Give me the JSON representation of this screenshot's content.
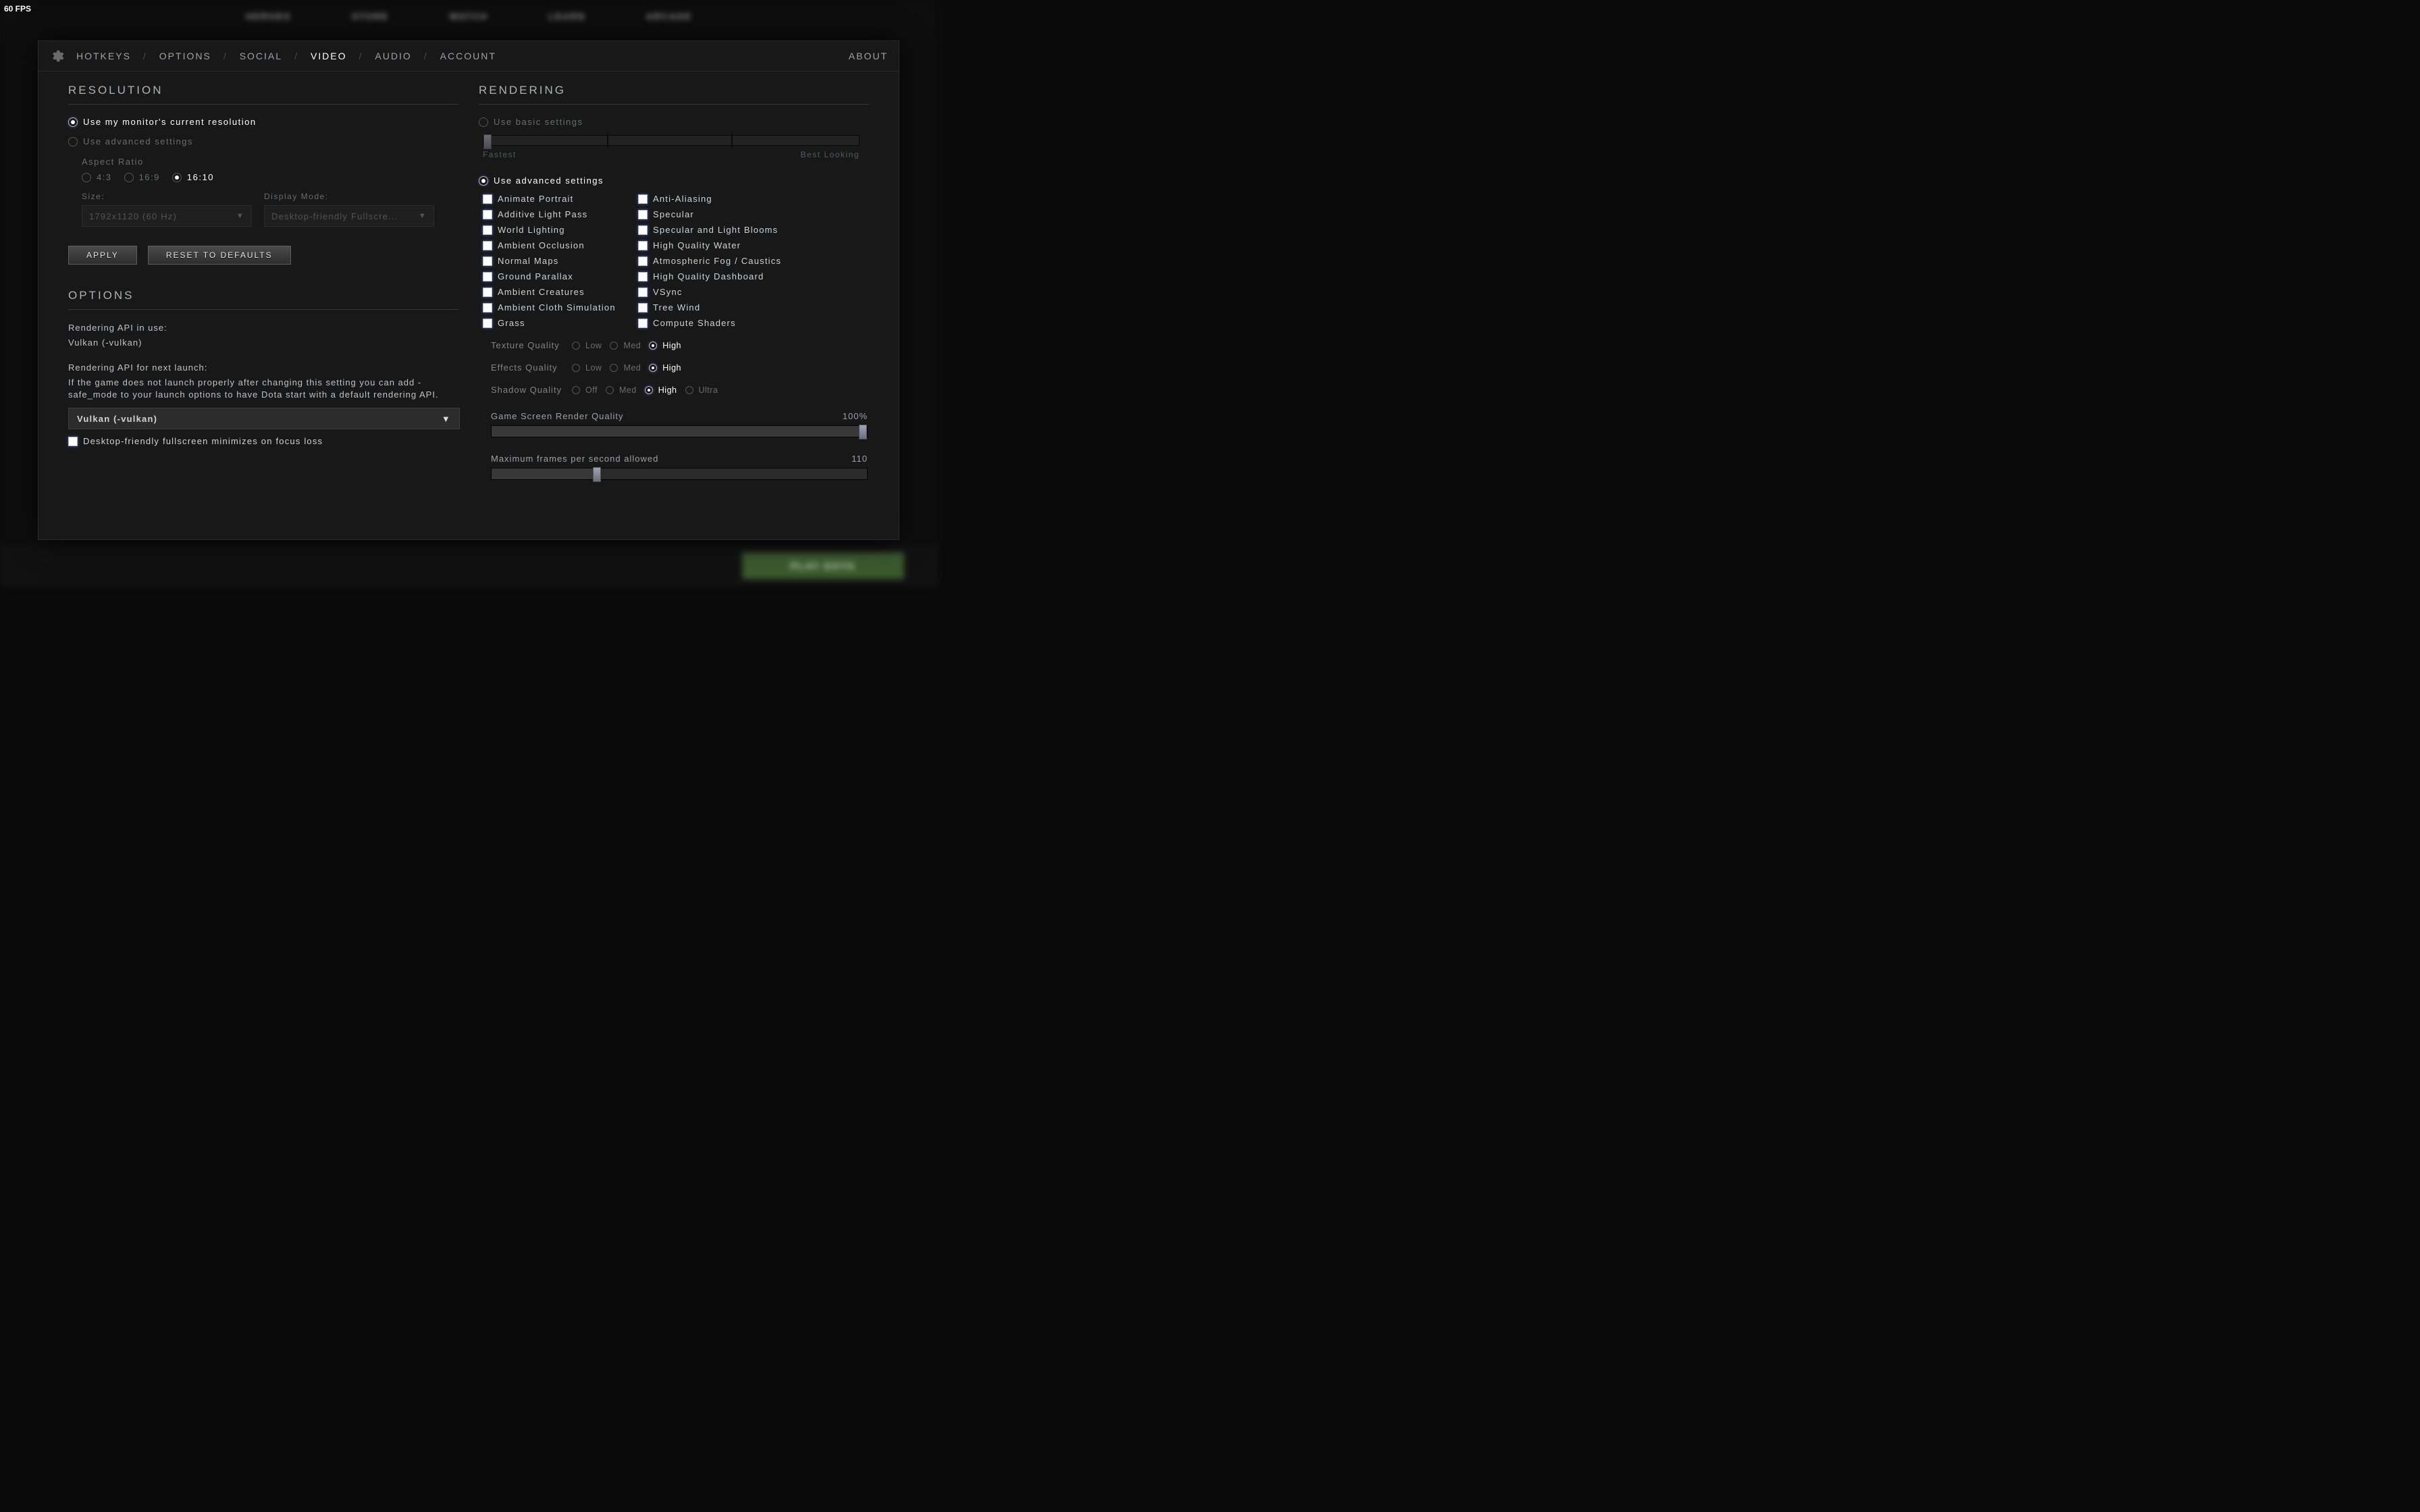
{
  "fps": "60 FPS",
  "nav_blur": [
    "HEROES",
    "STORE",
    "WATCH",
    "LEARN",
    "ARCADE"
  ],
  "play_label": "PLAY DOTA",
  "tabs": {
    "items": [
      "HOTKEYS",
      "OPTIONS",
      "SOCIAL",
      "VIDEO",
      "AUDIO",
      "ACCOUNT"
    ],
    "active": "VIDEO",
    "about": "ABOUT"
  },
  "resolution": {
    "title": "RESOLUTION",
    "use_current": "Use my monitor's current resolution",
    "use_advanced": "Use advanced settings",
    "aspect_label": "Aspect Ratio",
    "aspects": [
      "4:3",
      "16:9",
      "16:10"
    ],
    "aspect_selected": "16:10",
    "size_label": "Size:",
    "size_value": "1792x1120 (60 Hz)",
    "display_label": "Display Mode:",
    "display_value": "Desktop-friendly Fullscre...",
    "apply": "APPLY",
    "reset": "RESET TO DEFAULTS"
  },
  "options": {
    "title": "OPTIONS",
    "api_use_label": "Rendering API in use:",
    "api_use_value": "Vulkan (-vulkan)",
    "api_next_label": "Rendering API for next launch:",
    "api_next_help": "If the game does not launch properly after changing this setting you can add -safe_mode to your launch options to have Dota start with a default rendering API.",
    "api_select_value": "Vulkan (-vulkan)",
    "minimize_label": "Desktop-friendly fullscreen minimizes on focus loss"
  },
  "rendering": {
    "title": "RENDERING",
    "basic_label": "Use basic settings",
    "basic_left": "Fastest",
    "basic_right": "Best Looking",
    "advanced_label": "Use advanced settings",
    "checks_left": [
      "Animate Portrait",
      "Additive Light Pass",
      "World Lighting",
      "Ambient Occlusion",
      "Normal Maps",
      "Ground Parallax",
      "Ambient Creatures",
      "Ambient Cloth Simulation",
      "Grass"
    ],
    "checks_right": [
      "Anti-Aliasing",
      "Specular",
      "Specular and Light Blooms",
      "High Quality Water",
      "Atmospheric Fog / Caustics",
      "High Quality Dashboard",
      "VSync",
      "Tree Wind",
      "Compute Shaders"
    ],
    "texture": {
      "label": "Texture Quality",
      "opts": [
        "Low",
        "Med",
        "High"
      ],
      "sel": "High"
    },
    "effects": {
      "label": "Effects Quality",
      "opts": [
        "Low",
        "Med",
        "High"
      ],
      "sel": "High"
    },
    "shadow": {
      "label": "Shadow Quality",
      "opts": [
        "Off",
        "Med",
        "High",
        "Ultra"
      ],
      "sel": "High"
    },
    "render_quality": {
      "label": "Game Screen Render Quality",
      "value": "100%",
      "pct": 100
    },
    "max_fps": {
      "label": "Maximum frames per second allowed",
      "value": "110",
      "pct": 28
    }
  }
}
